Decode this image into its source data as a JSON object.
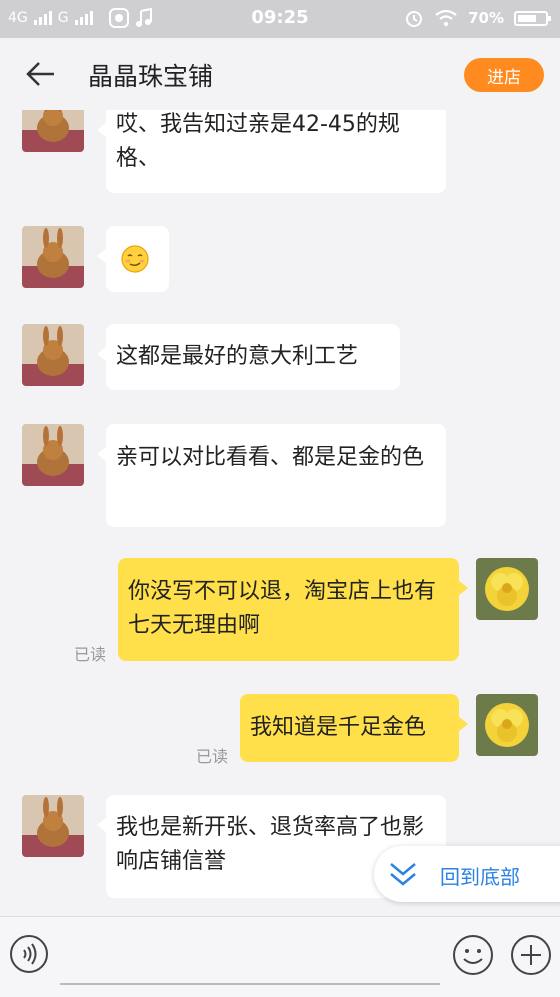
{
  "status_bar": {
    "network1": "4G",
    "network2": "G",
    "time": "09:25",
    "battery": "70%",
    "battery_level": 0.7
  },
  "header": {
    "back_icon": "back-arrow-icon",
    "title": "晶晶珠宝铺",
    "enter_label": "进店",
    "accent": "#ff8a1f"
  },
  "messages": [
    {
      "side": "in",
      "text": "哎、我告知过亲是42-45的规格、"
    },
    {
      "side": "in",
      "emoji": "smug-face-emoji"
    },
    {
      "side": "in",
      "text": "这都是最好的意大利工艺"
    },
    {
      "side": "in",
      "text": "亲可以对比看看、都是足金的色"
    },
    {
      "side": "out",
      "text": "你没写不可以退，淘宝店上也有七天无理由啊",
      "status": "已读"
    },
    {
      "side": "out",
      "text": "我知道是千足金色",
      "status": "已读"
    },
    {
      "side": "in",
      "text": "我也是新开张、退货率高了也影响店铺信誉"
    }
  ],
  "scroll_to_bottom": {
    "label": "回到底部",
    "color": "#2a82e4"
  },
  "input_bar": {
    "voice_icon": "voice-icon",
    "emoji_icon": "smiley-icon",
    "plus_icon": "plus-icon"
  }
}
